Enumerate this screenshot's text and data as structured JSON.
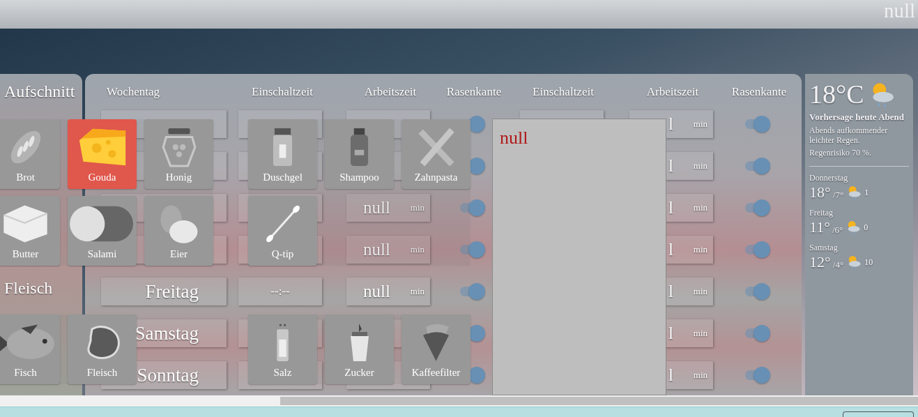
{
  "top_bar": {
    "title": "null"
  },
  "left_panel": {
    "headings": [
      "Aufschnitt",
      "Fleisch"
    ]
  },
  "table": {
    "columns": [
      "Wochentag",
      "Einschaltzeit",
      "Arbeitszeit",
      "Rasenkante",
      "Einschaltzeit",
      "Arbeitszeit",
      "Rasenkante"
    ],
    "rows": [
      {
        "edge_on": true,
        "work_2": "l",
        "unit_2": "min",
        "edge_2_on": true
      },
      {
        "edge_on": true,
        "work_2": "l",
        "unit_2": "min",
        "edge_2_on": true
      },
      {
        "work": "null",
        "unit": "min",
        "edge_on": true,
        "work_2": "l",
        "unit_2": "min",
        "edge_2_on": true
      },
      {
        "work": "null",
        "unit": "min",
        "edge_on": true,
        "work_2": "l",
        "unit_2": "min",
        "edge_2_on": true
      },
      {
        "day": "Freitag",
        "start": "--:--",
        "work": "null",
        "unit": "min",
        "edge_on": true,
        "work_2": "l",
        "unit_2": "min",
        "edge_2_on": true
      },
      {
        "day": "Samstag",
        "edge_on": true,
        "work_2": "l",
        "unit_2": "min",
        "edge_2_on": true
      },
      {
        "day": "Sonntag",
        "edge_on": true,
        "work_2": "l",
        "unit_2": "min",
        "edge_2_on": true
      }
    ]
  },
  "note": {
    "text": "null"
  },
  "weather": {
    "temperature": "18°C",
    "title": "Vorhersage heute Abend",
    "lines": [
      "Abends aufkommender leichter Regen.",
      "Regenrisiko 70 %."
    ],
    "forecast": [
      {
        "day": "Donnerstag",
        "high": "18°",
        "low": "/7°",
        "rain": "1"
      },
      {
        "day": "Freitag",
        "high": "11°",
        "low": "/6°",
        "rain": "0"
      },
      {
        "day": "Samstag",
        "high": "12°",
        "low": "/4°",
        "rain": "10"
      }
    ]
  },
  "groups": [
    {
      "items": [
        {
          "label": "Brot",
          "kind": "bread",
          "selected": false
        },
        {
          "label": "Gouda",
          "kind": "cheese",
          "selected": true
        },
        {
          "label": "Honig",
          "kind": "jar",
          "selected": false
        },
        {
          "label": "Butter",
          "kind": "butter",
          "selected": false
        },
        {
          "label": "Salami",
          "kind": "salami",
          "selected": false
        },
        {
          "label": "Eier",
          "kind": "eggs",
          "selected": false
        }
      ]
    },
    {
      "items": [
        {
          "label": "Duschgel",
          "kind": "gel",
          "selected": false
        },
        {
          "label": "Shampoo",
          "kind": "shampoo",
          "selected": false
        },
        {
          "label": "Zahnpasta",
          "kind": "toothpaste",
          "selected": false
        },
        {
          "label": "Q-tip",
          "kind": "swab",
          "selected": false
        }
      ]
    },
    {
      "items": [
        {
          "label": "Fisch",
          "kind": "fish",
          "selected": false
        },
        {
          "label": "Fleisch",
          "kind": "steak",
          "selected": false
        }
      ]
    },
    {
      "items": [
        {
          "label": "Salz",
          "kind": "salt",
          "selected": false
        },
        {
          "label": "Zucker",
          "kind": "sugar",
          "selected": false
        },
        {
          "label": "Kaffeefilter",
          "kind": "filter",
          "selected": false
        }
      ]
    }
  ]
}
